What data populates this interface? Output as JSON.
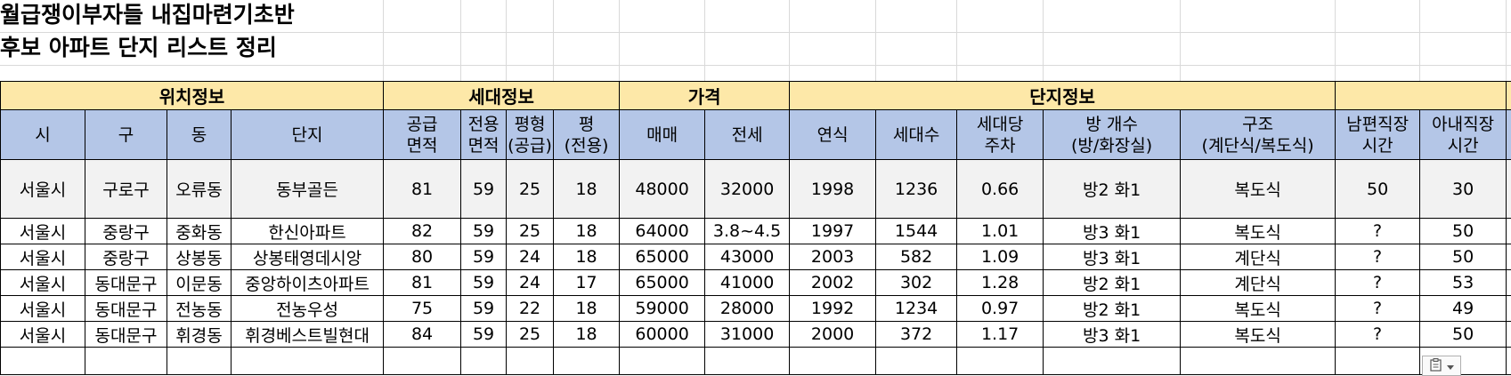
{
  "title": {
    "line1": "월급쟁이부자들 내집마련기초반",
    "line2": "후보 아파트 단지 리스트 정리"
  },
  "groups": [
    "위치정보",
    "세대정보",
    "가격",
    "단지정보",
    ""
  ],
  "columns": [
    [
      "시"
    ],
    [
      "구"
    ],
    [
      "동"
    ],
    [
      "단지"
    ],
    [
      "공급",
      "면적"
    ],
    [
      "전용",
      "면적"
    ],
    [
      "평형",
      "(공급)"
    ],
    [
      "평",
      "(전용)"
    ],
    [
      "매매"
    ],
    [
      "전세"
    ],
    [
      "연식"
    ],
    [
      "세대수"
    ],
    [
      "세대당",
      "주차"
    ],
    [
      "방 개수",
      "(방/화장실)"
    ],
    [
      "구조",
      "(계단식/복도식)"
    ],
    [
      "남편직장",
      "시간"
    ],
    [
      "아내직장",
      "시간"
    ]
  ],
  "rows": [
    [
      "서울시",
      "구로구",
      "오류동",
      "동부골든",
      "81",
      "59",
      "25",
      "18",
      "48000",
      "32000",
      "1998",
      "1236",
      "0.66",
      "방2 화1",
      "복도식",
      "50",
      "30"
    ],
    [
      "서울시",
      "중랑구",
      "중화동",
      "한신아파트",
      "82",
      "59",
      "25",
      "18",
      "64000",
      "3.8~4.5",
      "1997",
      "1544",
      "1.01",
      "방3 화1",
      "복도식",
      "?",
      "50"
    ],
    [
      "서울시",
      "중랑구",
      "상봉동",
      "상봉태영데시앙",
      "80",
      "59",
      "24",
      "18",
      "65000",
      "43000",
      "2003",
      "582",
      "1.09",
      "방3 화1",
      "계단식",
      "?",
      "50"
    ],
    [
      "서울시",
      "동대문구",
      "이문동",
      "중앙하이츠아파트",
      "81",
      "59",
      "24",
      "17",
      "65000",
      "41000",
      "2002",
      "302",
      "1.28",
      "방2 화1",
      "계단식",
      "?",
      "53"
    ],
    [
      "서울시",
      "동대문구",
      "전농동",
      "전농우성",
      "75",
      "59",
      "22",
      "18",
      "59000",
      "28000",
      "1992",
      "1234",
      "0.97",
      "방2 화1",
      "복도식",
      "?",
      "49"
    ],
    [
      "서울시",
      "동대문구",
      "휘경동",
      "휘경베스트빌현대",
      "84",
      "59",
      "25",
      "18",
      "60000",
      "31000",
      "2000",
      "372",
      "1.17",
      "방3 화1",
      "복도식",
      "?",
      "50"
    ]
  ],
  "colors": {
    "group_header_bg": "#fde8a8",
    "column_header_bg": "#b4c6e7",
    "first_row_bg": "#f2f2f2",
    "gridline": "#d9d9d9"
  },
  "icons": {
    "paste_options": "clipboard-icon",
    "paste_options_arrow": "chevron-down-icon"
  }
}
